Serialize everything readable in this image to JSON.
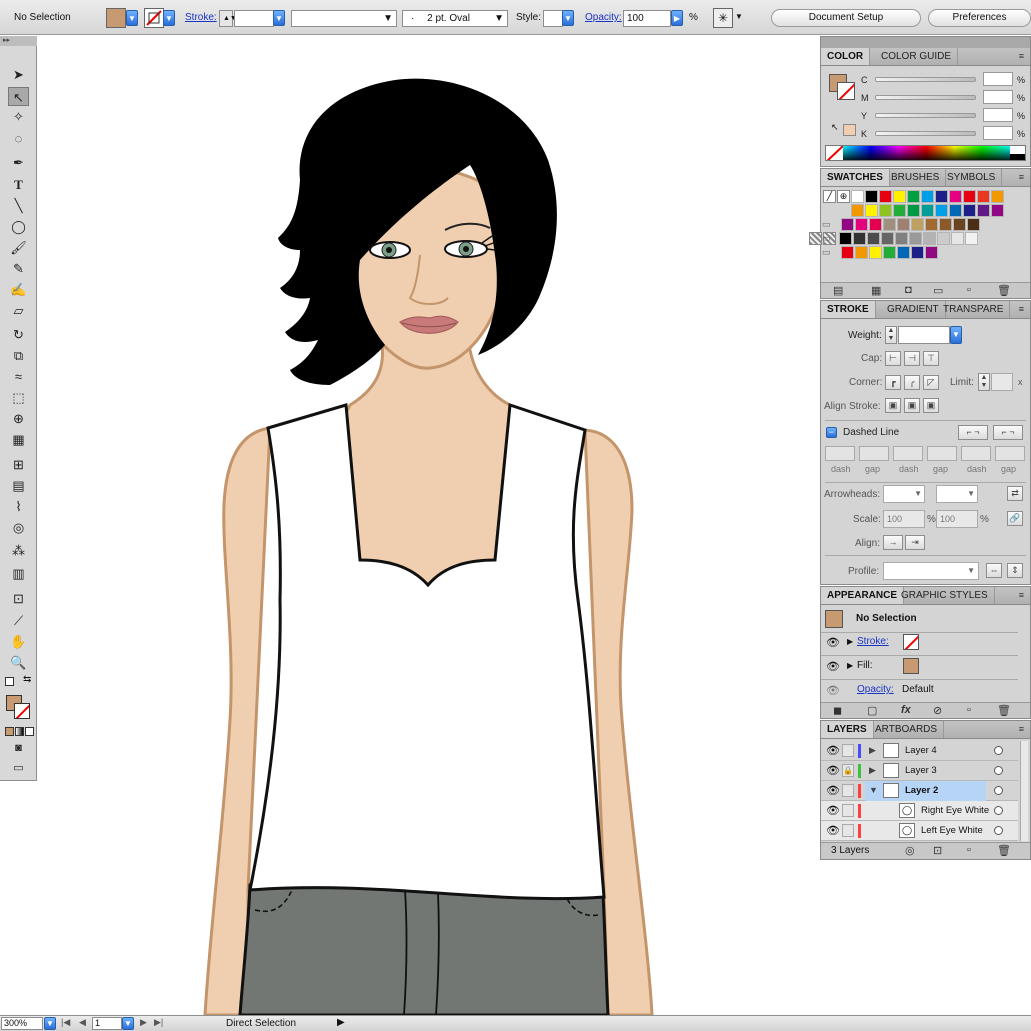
{
  "control_bar": {
    "selection_status": "No Selection",
    "stroke_label": "Stroke:",
    "brush_prefix": "·",
    "brush_value": "2 pt. Oval",
    "style_label": "Style:",
    "opacity_label": "Opacity:",
    "opacity_value": "100",
    "opacity_unit": "%",
    "document_setup_label": "Document Setup",
    "preferences_label": "Preferences"
  },
  "colors": {
    "fill": "#c89a72",
    "skin": "#f0cfb1",
    "skin_outline": "#c4956b",
    "hair": "#000000",
    "pants": "#727773",
    "lips": "#c77a78",
    "iris": "#7aa08a",
    "accent_blue": "#2a6fd8",
    "selected_layer": "#b6d4f5"
  },
  "color_panel": {
    "tabs": [
      "COLOR",
      "COLOR GUIDE"
    ],
    "channels": [
      "C",
      "M",
      "Y",
      "K"
    ],
    "unit": "%"
  },
  "swatches_panel": {
    "tabs": [
      "SWATCHES",
      "BRUSHES",
      "SYMBOLS"
    ],
    "rows": [
      [
        "#ffffff",
        "#000000",
        "#e60012",
        "#fff100",
        "#00a040",
        "#00a0e9",
        "#1d2088",
        "#e4007f",
        "#e60012",
        "#e83820",
        "#f39800"
      ],
      [
        "#f39800",
        "#fff100",
        "#8fc31f",
        "#22ac38",
        "#009944",
        "#009e96",
        "#00a0e9",
        "#0068b7",
        "#1d2088",
        "#601986",
        "#920783"
      ],
      [
        "#920783",
        "#e4007f",
        "#e5004f",
        "#9f8f7f",
        "#a08070",
        "#c0a060",
        "#a06a30",
        "#8a5a2b",
        "#6a4420",
        "#4a2e15"
      ],
      [
        "#000000",
        "#333333",
        "#4d4d4d",
        "#666666",
        "#808080",
        "#999999",
        "#b3b3b3",
        "#cccccc",
        "#e6e6e6",
        "#f2f2f2"
      ],
      [
        "#e60012",
        "#f39800",
        "#fff100",
        "#22ac38",
        "#0068b7",
        "#1d2088",
        "#920783"
      ]
    ]
  },
  "stroke_panel": {
    "tabs": [
      "STROKE",
      "GRADIENT",
      "TRANSPARE"
    ],
    "weight_label": "Weight:",
    "cap_label": "Cap:",
    "corner_label": "Corner:",
    "limit_label": "Limit:",
    "limit_unit": "x",
    "align_stroke_label": "Align Stroke:",
    "dashed_line_label": "Dashed Line",
    "dash_labels": [
      "dash",
      "gap",
      "dash",
      "gap",
      "dash",
      "gap"
    ],
    "arrowheads_label": "Arrowheads:",
    "scale_label": "Scale:",
    "scale_start": "100",
    "scale_end": "100",
    "scale_unit": "%",
    "align_label": "Align:",
    "profile_label": "Profile:"
  },
  "appearance_panel": {
    "tabs": [
      "APPEARANCE",
      "GRAPHIC STYLES"
    ],
    "title": "No Selection",
    "stroke_label": "Stroke:",
    "fill_label": "Fill:",
    "opacity_label": "Opacity:",
    "opacity_value": "Default"
  },
  "layers_panel": {
    "tabs": [
      "LAYERS",
      "ARTBOARDS"
    ],
    "layers": [
      {
        "name": "Layer 4",
        "color": "#4a4aff"
      },
      {
        "name": "Layer 3",
        "color": "#40c040"
      },
      {
        "name": "Layer 2",
        "color": "#ff4040"
      },
      {
        "name": "Right Eye White",
        "color": "#ff4040"
      },
      {
        "name": "Left Eye White",
        "color": "#ff4040"
      }
    ],
    "count_label": "3 Layers"
  },
  "status_bar": {
    "zoom": "300%",
    "artboard_number": "1",
    "tool_status": "Direct Selection"
  }
}
